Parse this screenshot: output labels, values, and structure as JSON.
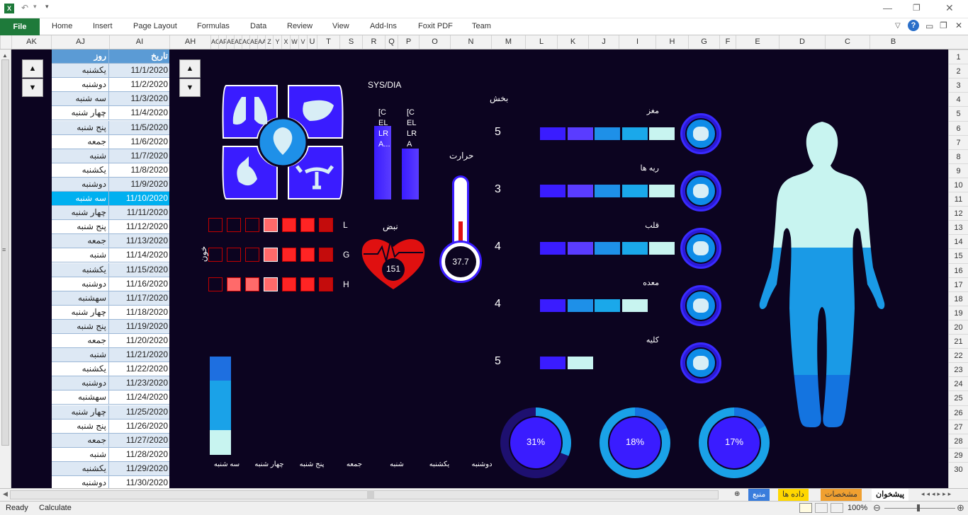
{
  "ribbon": {
    "file": "File",
    "tabs": [
      "Home",
      "Insert",
      "Page Layout",
      "Formulas",
      "Data",
      "Review",
      "View",
      "Add-Ins",
      "Foxit PDF",
      "Team"
    ]
  },
  "columns": [
    {
      "label": "AK",
      "w": 56
    },
    {
      "label": "AJ",
      "w": 82
    },
    {
      "label": "AI",
      "w": 85
    },
    {
      "label": "AH",
      "w": 58
    },
    {
      "label": "AG",
      "w": 11
    },
    {
      "label": "AF",
      "w": 11
    },
    {
      "label": "AE",
      "w": 11
    },
    {
      "label": "AD",
      "w": 11
    },
    {
      "label": "AC",
      "w": 11
    },
    {
      "label": "AB",
      "w": 11
    },
    {
      "label": "AA",
      "w": 11
    },
    {
      "label": "Z",
      "w": 11
    },
    {
      "label": "Y",
      "w": 12
    },
    {
      "label": "X",
      "w": 12
    },
    {
      "label": "W",
      "w": 12
    },
    {
      "label": "V",
      "w": 12
    },
    {
      "label": "U",
      "w": 14
    },
    {
      "label": "T",
      "w": 32
    },
    {
      "label": "S",
      "w": 32
    },
    {
      "label": "R",
      "w": 32
    },
    {
      "label": "Q",
      "w": 18
    },
    {
      "label": "P",
      "w": 30
    },
    {
      "label": "O",
      "w": 44
    },
    {
      "label": "N",
      "w": 58
    },
    {
      "label": "M",
      "w": 48
    },
    {
      "label": "L",
      "w": 45
    },
    {
      "label": "K",
      "w": 44
    },
    {
      "label": "J",
      "w": 43
    },
    {
      "label": "I",
      "w": 52
    },
    {
      "label": "H",
      "w": 46
    },
    {
      "label": "G",
      "w": 44
    },
    {
      "label": "F",
      "w": 23
    },
    {
      "label": "E",
      "w": 61
    },
    {
      "label": "D",
      "w": 65
    },
    {
      "label": "C",
      "w": 63
    },
    {
      "label": "B",
      "w": 66
    }
  ],
  "rows": [
    "1",
    "2",
    "3",
    "4",
    "5",
    "6",
    "7",
    "8",
    "9",
    "10",
    "11",
    "12",
    "13",
    "14",
    "15",
    "16",
    "17",
    "18",
    "19",
    "20",
    "21",
    "22",
    "23",
    "24",
    "25",
    "26",
    "27",
    "28",
    "29",
    "30"
  ],
  "date_table": {
    "header_day": "روز",
    "header_date": "تاریخ",
    "rows": [
      {
        "day": "یکشنبه",
        "date": "11/1/2020"
      },
      {
        "day": "دوشنبه",
        "date": "11/2/2020"
      },
      {
        "day": "سه شنبه",
        "date": "11/3/2020"
      },
      {
        "day": "چهار شنبه",
        "date": "11/4/2020"
      },
      {
        "day": "پنج شنبه",
        "date": "11/5/2020"
      },
      {
        "day": "جمعه",
        "date": "11/6/2020"
      },
      {
        "day": "شنبه",
        "date": "11/7/2020"
      },
      {
        "day": "یکشنبه",
        "date": "11/8/2020"
      },
      {
        "day": "دوشنبه",
        "date": "11/9/2020"
      },
      {
        "day": "سه شنبه",
        "date": "11/10/2020",
        "selected": true
      },
      {
        "day": "چهار شنبه",
        "date": "11/11/2020"
      },
      {
        "day": "پنج شنبه",
        "date": "11/12/2020"
      },
      {
        "day": "جمعه",
        "date": "11/13/2020"
      },
      {
        "day": "شنبه",
        "date": "11/14/2020"
      },
      {
        "day": "یکشنبه",
        "date": "11/15/2020"
      },
      {
        "day": "دوشنبه",
        "date": "11/16/2020"
      },
      {
        "day": "سهشنبه",
        "date": "11/17/2020"
      },
      {
        "day": "چهار شنبه",
        "date": "11/18/2020"
      },
      {
        "day": "پنج شنبه",
        "date": "11/19/2020"
      },
      {
        "day": "جمعه",
        "date": "11/20/2020"
      },
      {
        "day": "شنبه",
        "date": "11/21/2020"
      },
      {
        "day": "یکشنبه",
        "date": "11/22/2020"
      },
      {
        "day": "دوشنبه",
        "date": "11/23/2020"
      },
      {
        "day": "سهشنبه",
        "date": "11/24/2020"
      },
      {
        "day": "چهار شنبه",
        "date": "11/25/2020"
      },
      {
        "day": "پنج شنبه",
        "date": "11/26/2020"
      },
      {
        "day": "جمعه",
        "date": "11/27/2020"
      },
      {
        "day": "شنبه",
        "date": "11/28/2020"
      },
      {
        "day": "یکشنبه",
        "date": "11/29/2020"
      },
      {
        "day": "دوشنبه",
        "date": "11/30/2020"
      }
    ]
  },
  "blood": {
    "label": "خون",
    "rows": [
      {
        "letter": "L",
        "cells": [
          "e",
          "e",
          "e",
          "p",
          "r",
          "r",
          "d"
        ]
      },
      {
        "letter": "G",
        "cells": [
          "e",
          "e",
          "e",
          "p",
          "r",
          "r",
          "d"
        ]
      },
      {
        "letter": "H",
        "cells": [
          "e",
          "p",
          "p",
          "p",
          "r",
          "r",
          "d"
        ]
      }
    ]
  },
  "sysdia": {
    "title": "SYS/DIA",
    "label1": [
      "[C",
      "EL",
      "LR",
      "A..."
    ],
    "label2": [
      "[C",
      "EL",
      "LR",
      "A"
    ]
  },
  "pulse": {
    "label": "نبض",
    "value": "151"
  },
  "temperature": {
    "label": "حرارت",
    "value": "37.7",
    "level": 0.38
  },
  "weekdays": [
    "سه شنبه",
    "چهار شنبه",
    "پنج شنبه",
    "جمعه",
    "شنبه",
    "یکشنبه",
    "دوشنبه"
  ],
  "section_label": "بخش",
  "organs": [
    {
      "name": "مغز",
      "score": "5",
      "segments": 5,
      "icon": "liver-icon"
    },
    {
      "name": "ریه ها",
      "score": "3",
      "segments": 5,
      "icon": "lungs-icon"
    },
    {
      "name": "قلب",
      "score": "4",
      "segments": 5,
      "icon": "heart-icon"
    },
    {
      "name": "معده",
      "score": "4",
      "segments": 4,
      "icon": "stomach-icon"
    },
    {
      "name": "کلیه",
      "score": "5",
      "segments": 2,
      "icon": "uterus-icon"
    }
  ],
  "donuts": [
    {
      "label": "31%",
      "value": 0.31
    },
    {
      "label": "18%",
      "value": 0.18
    },
    {
      "label": "17%",
      "value": 0.17
    }
  ],
  "sheets": [
    "پیشخوان",
    "مشخصات",
    "داده ها",
    "منبع"
  ],
  "status": {
    "ready": "Ready",
    "calculate": "Calculate",
    "zoom": "100%"
  },
  "colors": {
    "bg": "#0c0420",
    "purple": "#3a1cff",
    "blue": "#1e90e8",
    "cyan": "#2fb4f0",
    "pale": "#c8f4f0",
    "red": "#e01010"
  }
}
